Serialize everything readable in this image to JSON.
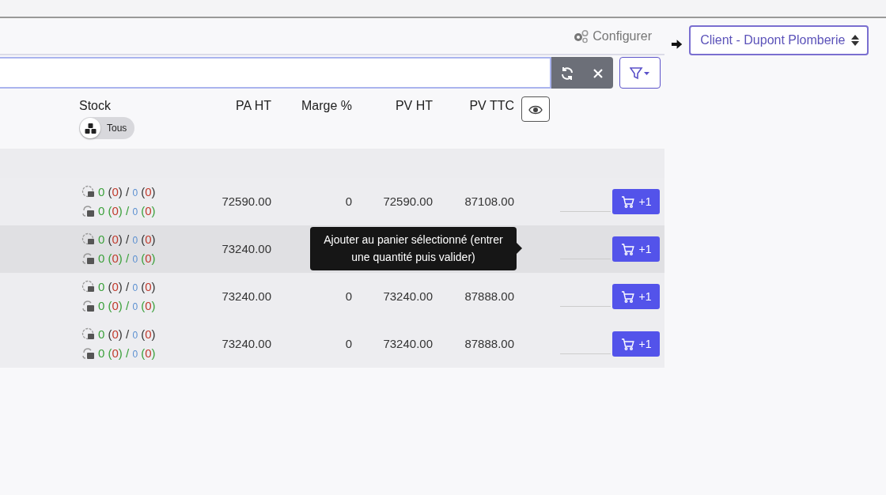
{
  "configure_link": "Configurer",
  "client_select": {
    "value": "Client - Dupont Plomberie"
  },
  "columns": {
    "stock": "Stock",
    "stock_filter": "Tous",
    "pa_ht": "PA HT",
    "marge": "Marge %",
    "pv_ht": "PV HT",
    "pv_ttc": "PV TTC"
  },
  "rows": [
    {
      "hover": false,
      "stock": [
        {
          "kind": "physical",
          "text": "0 (0) / 0 (0)"
        },
        {
          "kind": "virtual",
          "text": "0 (0) / 0 (0)"
        }
      ],
      "pa_ht": "72590.00",
      "marge": "0",
      "pv_ht": "72590.00",
      "pv_ttc": "87108.00",
      "button": "+1"
    },
    {
      "hover": true,
      "stock": [
        {
          "kind": "physical",
          "text": "0 (0) / 0 (0)"
        },
        {
          "kind": "virtual",
          "text": "0 (0) / 0 (0)"
        }
      ],
      "pa_ht": "73240.00",
      "button": "+1"
    },
    {
      "hover": false,
      "stock": [
        {
          "kind": "physical",
          "text": "0 (0) / 0 (0)"
        },
        {
          "kind": "virtual",
          "text": "0 (0) / 0 (0)"
        }
      ],
      "pa_ht": "73240.00",
      "marge": "0",
      "pv_ht": "73240.00",
      "pv_ttc": "87888.00",
      "button": "+1"
    },
    {
      "hover": false,
      "stock": [
        {
          "kind": "physical",
          "text": "0 (0) / 0 (0)"
        },
        {
          "kind": "virtual",
          "text": "0 (0) / 0 (0)"
        }
      ],
      "pa_ht": "73240.00",
      "marge": "0",
      "pv_ht": "73240.00",
      "pv_ttc": "87888.00",
      "button": "+1"
    }
  ],
  "tooltip": {
    "text": "Ajouter au panier sélectionné (entrer une quantité puis valider)"
  }
}
